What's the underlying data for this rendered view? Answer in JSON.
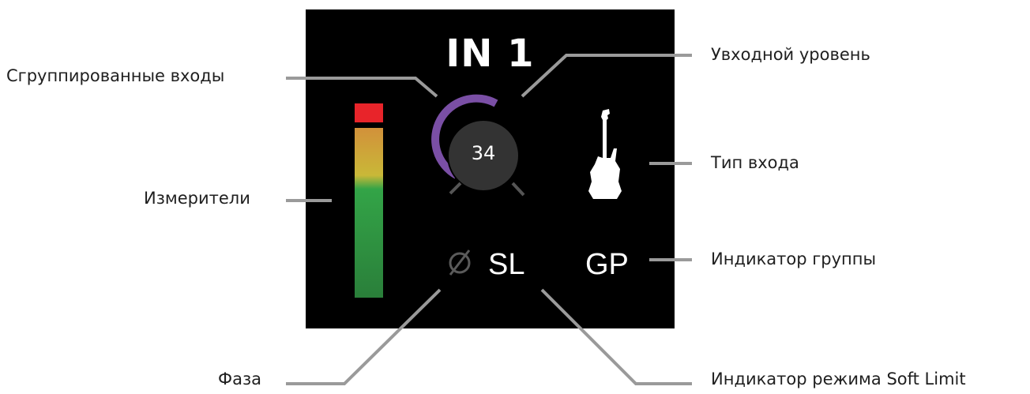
{
  "panel": {
    "channel_title": "IN 1",
    "gain_value": "34",
    "soft_limit_label": "SL",
    "group_label": "GP"
  },
  "callouts": {
    "grouped_inputs": "Сгруппированные входы",
    "input_level": "Увходной уровень",
    "input_type": "Тип входа",
    "meters": "Измерители",
    "group_indicator": "Индикатор группы",
    "phase": "Фаза",
    "soft_limit_indicator": "Индикатор режима Soft Limit"
  },
  "icons": {
    "phase": "phase-invert-icon",
    "input_type": "electric-guitar-icon"
  },
  "colors": {
    "panel_bg": "#000000",
    "knob_ring": "#7a4fa5",
    "meter_clip": "#e8242a",
    "meter_top": "#d2913a",
    "meter_mid": "#c9b838",
    "meter_bottom": "#2f9a43",
    "leader_line": "#9a9a9a"
  }
}
